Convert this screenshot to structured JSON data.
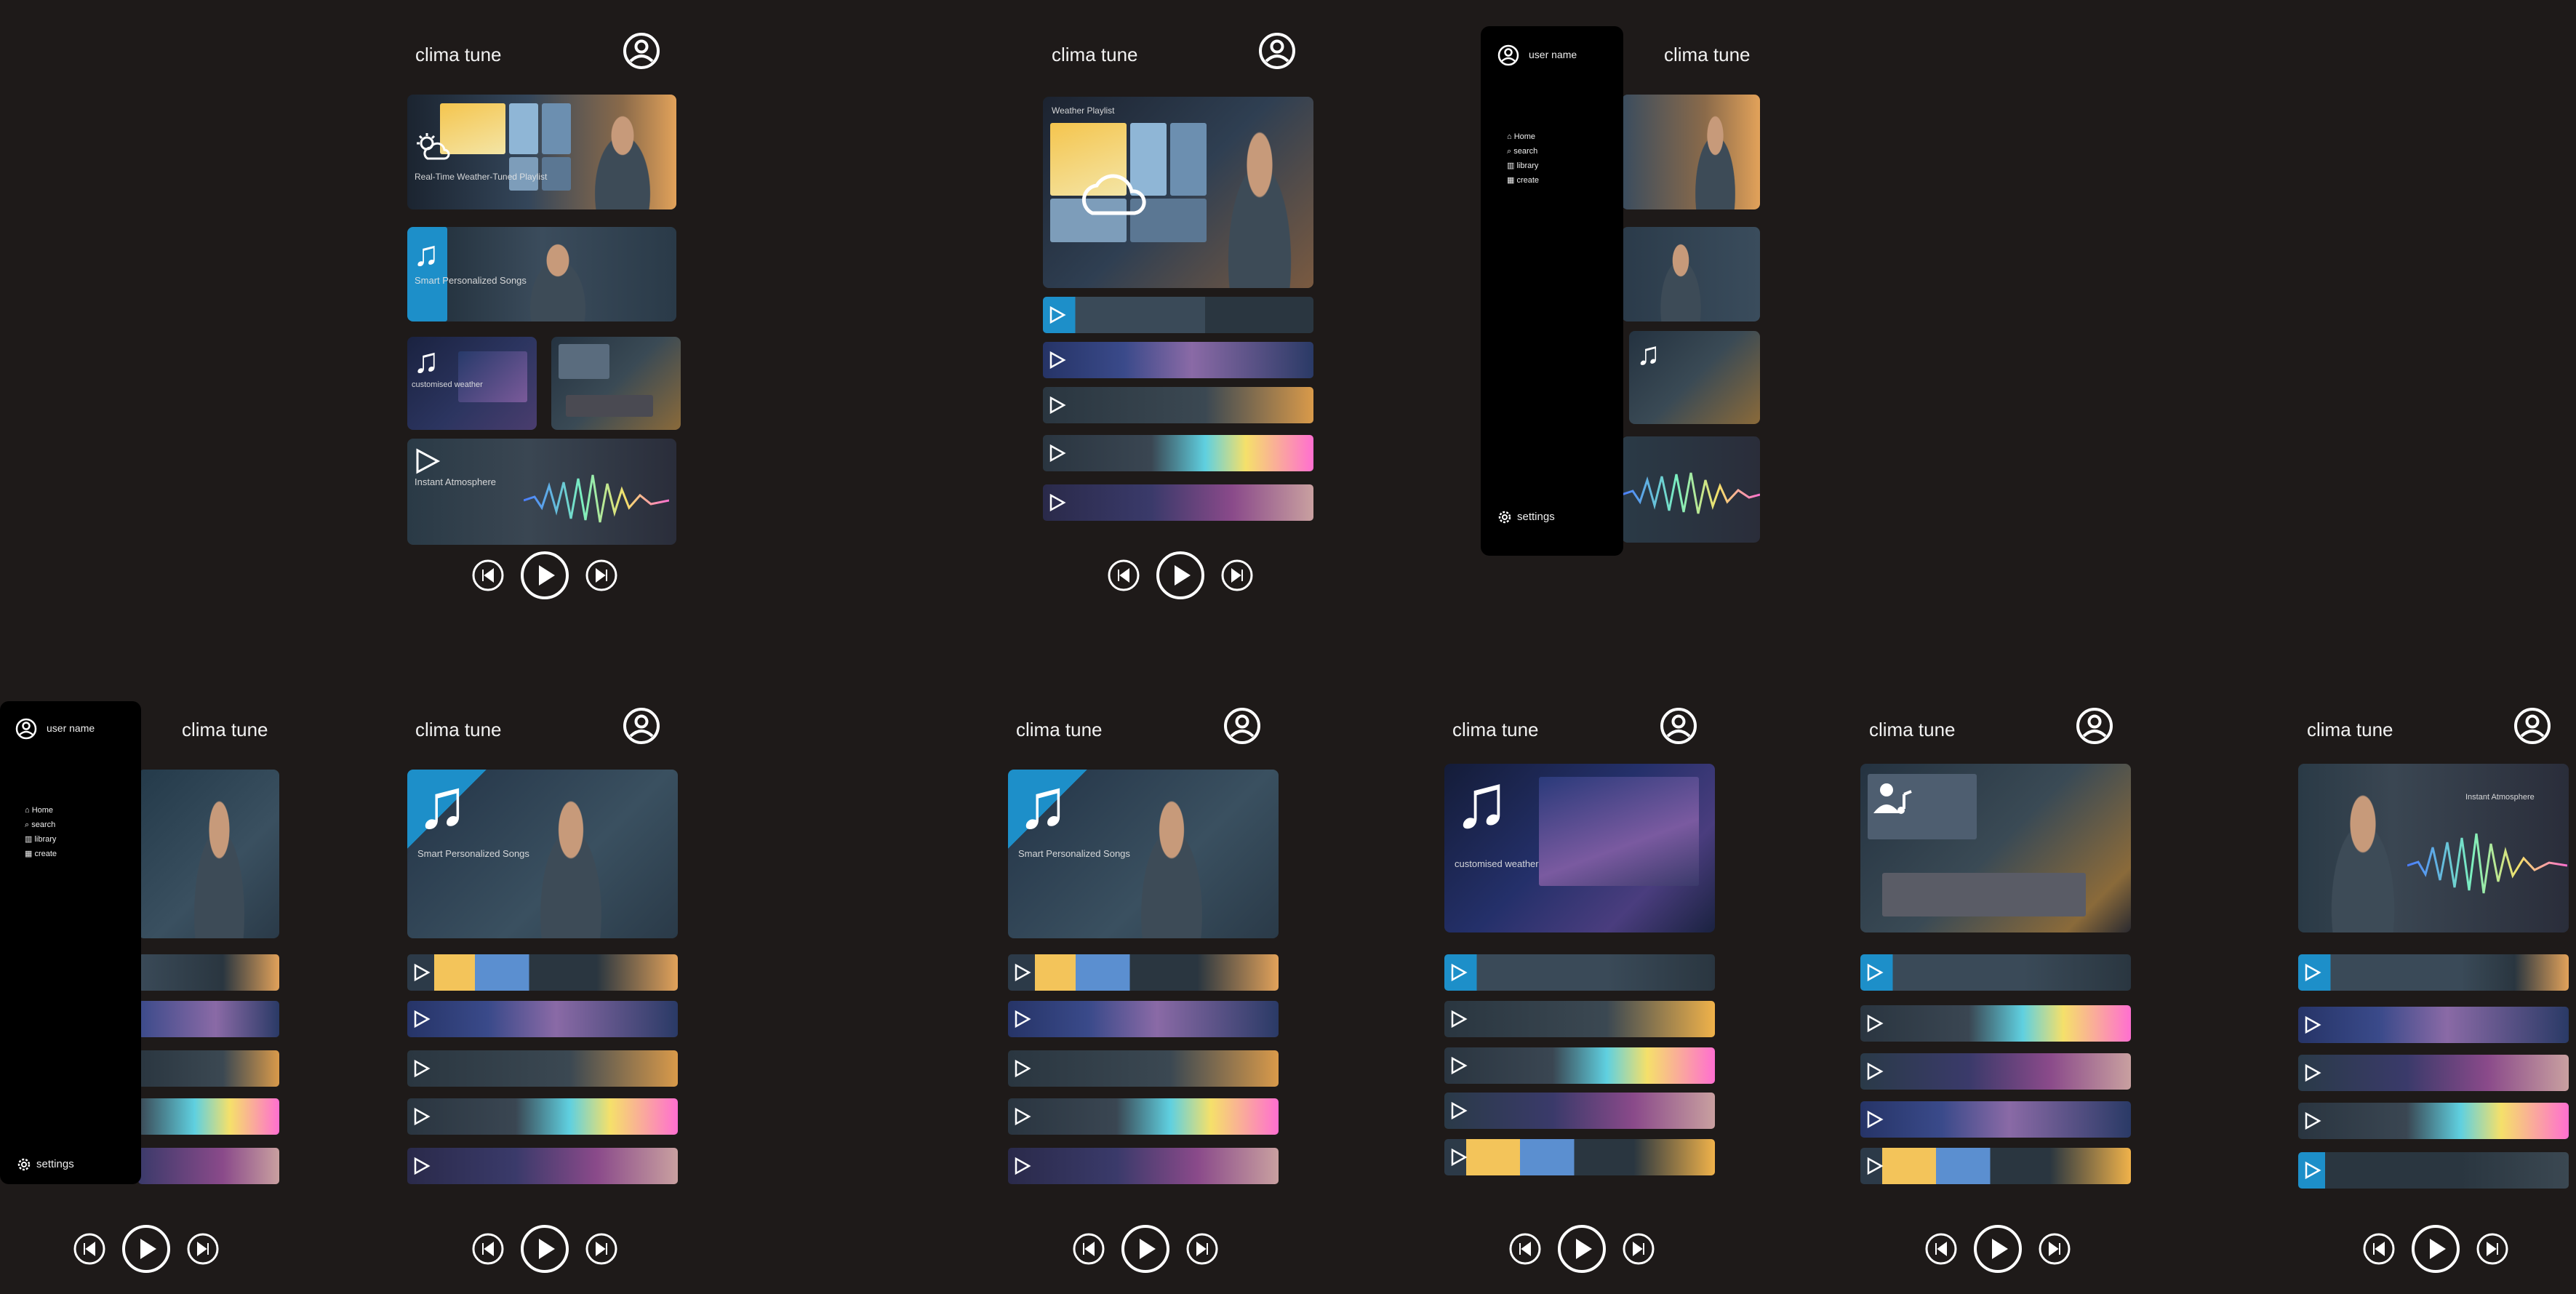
{
  "app": {
    "title": "clima tune",
    "labels": {
      "realtime": "Real-Time Weather-Tuned Playlist",
      "smart": "Smart Personalized Songs",
      "customised": "customised weather",
      "instant": "Instant Atmosphere",
      "weather_playlist": "Weather Playlist",
      "instant_atmosphere_small": "Instant Atmosphere"
    }
  },
  "sidebar": {
    "user_name": "user name",
    "items": [
      {
        "label": "Home",
        "icon": "home-icon"
      },
      {
        "label": "search",
        "icon": "search-icon"
      },
      {
        "label": "library",
        "icon": "library-icon"
      },
      {
        "label": "create",
        "icon": "create-icon"
      }
    ],
    "settings": "settings"
  },
  "icons": {
    "profile": "user-circle-icon",
    "prev": "skip-back-icon",
    "play": "play-icon",
    "next": "skip-forward-icon",
    "note": "music-note-icon",
    "weather": "sun-cloud-icon"
  },
  "colors": {
    "background": "#1e1a19",
    "sidebar": "#000000",
    "text": "#f2f2f2",
    "accent_gold": "#f0b24a",
    "accent_blue": "#2c8ec8"
  }
}
